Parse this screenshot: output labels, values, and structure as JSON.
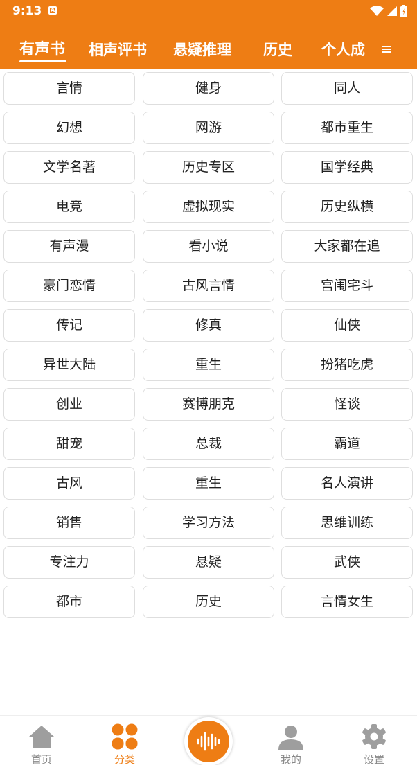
{
  "colors": {
    "accent": "#ee7d14",
    "nav_inactive": "#9e9e9e",
    "card_border": "#dedede"
  },
  "status_bar": {
    "time": "9:13",
    "notification_icon": "A"
  },
  "tabs": [
    {
      "label": "有声书",
      "active": true
    },
    {
      "label": "相声评书",
      "active": false
    },
    {
      "label": "悬疑推理",
      "active": false
    },
    {
      "label": "历史",
      "active": false
    },
    {
      "label": "个人成",
      "active": false
    }
  ],
  "categories": [
    "言情",
    "健身",
    "同人",
    "幻想",
    "网游",
    "都市重生",
    "文学名著",
    "历史专区",
    "国学经典",
    "电竞",
    "虚拟现实",
    "历史纵横",
    "有声漫",
    "看小说",
    "大家都在追",
    "豪门恋情",
    "古风言情",
    "宫闱宅斗",
    "传记",
    "修真",
    "仙侠",
    "异世大陆",
    "重生",
    "扮猪吃虎",
    "创业",
    "赛博朋克",
    "怪谈",
    "甜宠",
    "总裁",
    "霸道",
    "古风",
    "重生",
    "名人演讲",
    "销售",
    "学习方法",
    "思维训练",
    "专注力",
    "悬疑",
    "武侠",
    "都市",
    "历史",
    "言情女生"
  ],
  "bottom_nav": {
    "home": {
      "label": "首页",
      "icon": "home-icon"
    },
    "category": {
      "label": "分类",
      "icon": "category-grid-icon"
    },
    "player": {
      "icon": "audio-wave-icon"
    },
    "mine": {
      "label": "我的",
      "icon": "user-icon"
    },
    "settings": {
      "label": "设置",
      "icon": "gear-icon"
    }
  }
}
